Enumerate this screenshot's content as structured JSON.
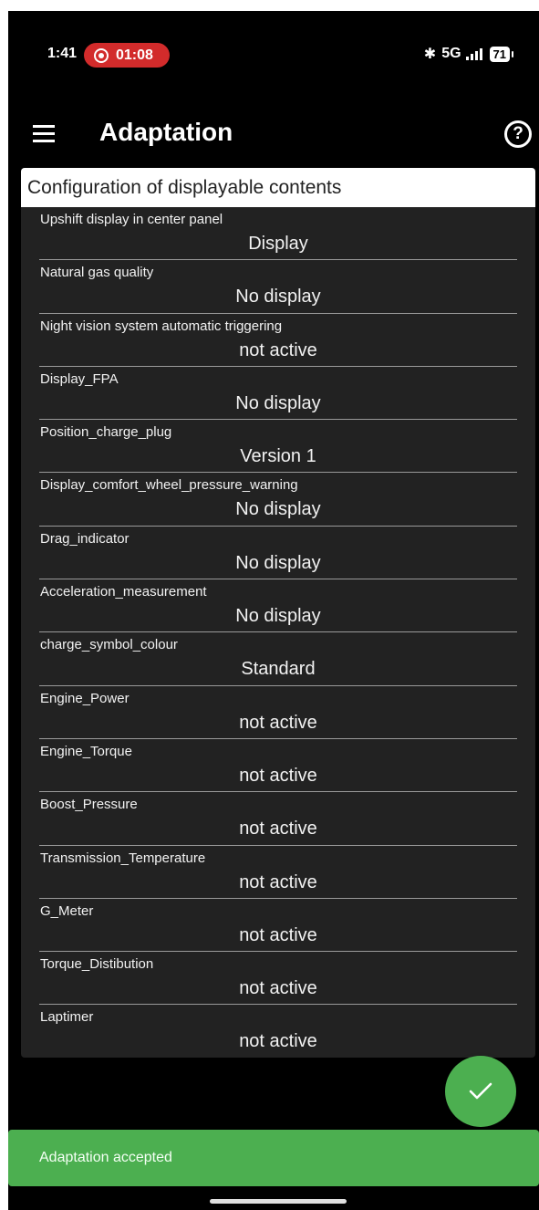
{
  "status_bar": {
    "time": "1:41",
    "recording": "01:08",
    "network": "5G",
    "battery": "71",
    "icons": [
      "bluetooth-icon",
      "signal-icon",
      "battery-icon",
      "recording-icon"
    ]
  },
  "app_bar": {
    "title": "Adaptation",
    "menu_icon": "menu-icon",
    "help_icon": "help-icon"
  },
  "panel": {
    "header": "Configuration of displayable contents",
    "rows": [
      {
        "label": "Upshift display in center panel",
        "value": "Display"
      },
      {
        "label": "Natural gas quality",
        "value": "No display"
      },
      {
        "label": "Night vision system automatic triggering",
        "value": "not active"
      },
      {
        "label": "Display_FPA",
        "value": "No display"
      },
      {
        "label": "Position_charge_plug",
        "value": "Version 1"
      },
      {
        "label": "Display_comfort_wheel_pressure_warning",
        "value": "No display"
      },
      {
        "label": "Drag_indicator",
        "value": "No display"
      },
      {
        "label": "Acceleration_measurement",
        "value": "No display"
      },
      {
        "label": "charge_symbol_colour",
        "value": "Standard"
      },
      {
        "label": "Engine_Power",
        "value": "not active"
      },
      {
        "label": "Engine_Torque",
        "value": "not active"
      },
      {
        "label": "Boost_Pressure",
        "value": "not active"
      },
      {
        "label": "Transmission_Temperature",
        "value": "not active"
      },
      {
        "label": "G_Meter",
        "value": "not active"
      },
      {
        "label": "Torque_Distibution",
        "value": "not active"
      },
      {
        "label": "Laptimer",
        "value": "not active"
      }
    ]
  },
  "fab": {
    "icon": "checkmark-icon"
  },
  "snackbar": {
    "message": "Adaptation accepted"
  },
  "colors": {
    "accent": "#4caf50",
    "recording": "#d22b2b",
    "panel_bg": "#222222",
    "background": "#000000"
  }
}
